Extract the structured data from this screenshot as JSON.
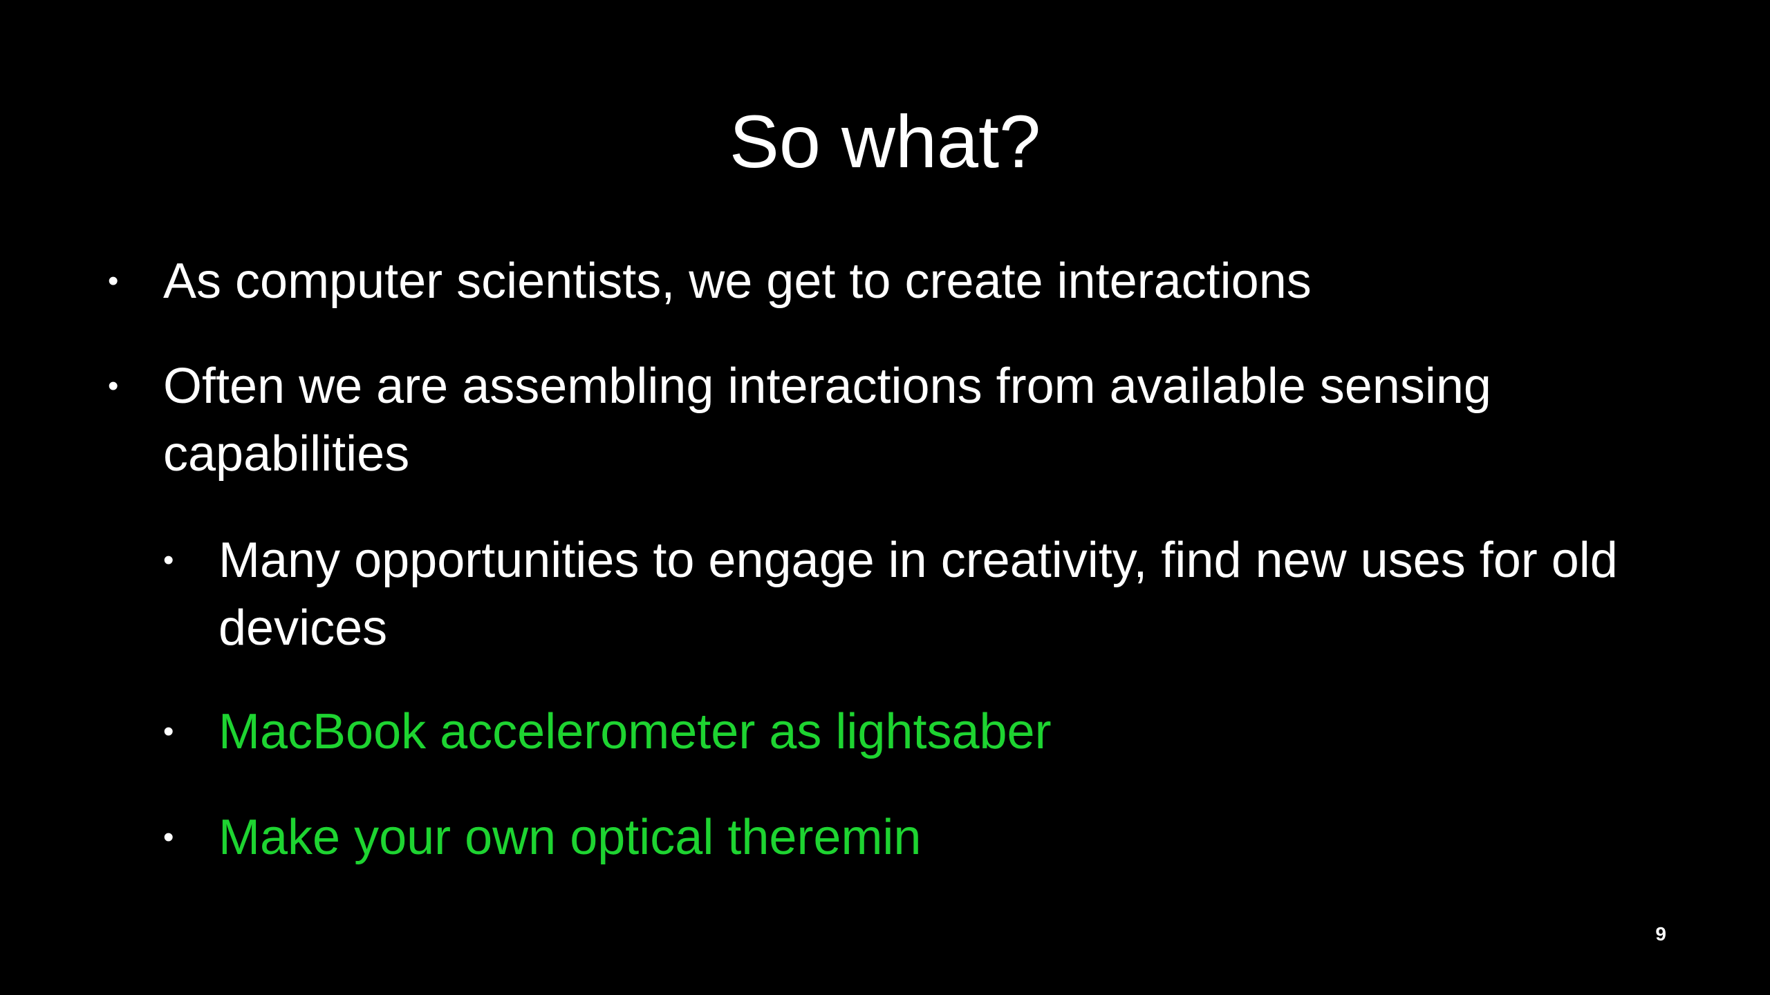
{
  "slide": {
    "title": "So what?",
    "bullets": [
      {
        "level": 1,
        "text": "As computer scientists, we get to create interactions",
        "highlight": false
      },
      {
        "level": 1,
        "text": "Often we are assembling interactions from available sensing capabilities",
        "highlight": false
      },
      {
        "level": 2,
        "text": "Many opportunities to engage in creativity, find new uses for old devices",
        "highlight": false
      },
      {
        "level": 2,
        "text": "MacBook accelerometer as lightsaber",
        "highlight": true
      },
      {
        "level": 2,
        "text": "Make your own optical theremin",
        "highlight": true
      }
    ],
    "bullet_symbol": "•",
    "page_number": "9"
  },
  "colors": {
    "background": "#000000",
    "text": "#ffffff",
    "highlight": "#1ed431"
  }
}
